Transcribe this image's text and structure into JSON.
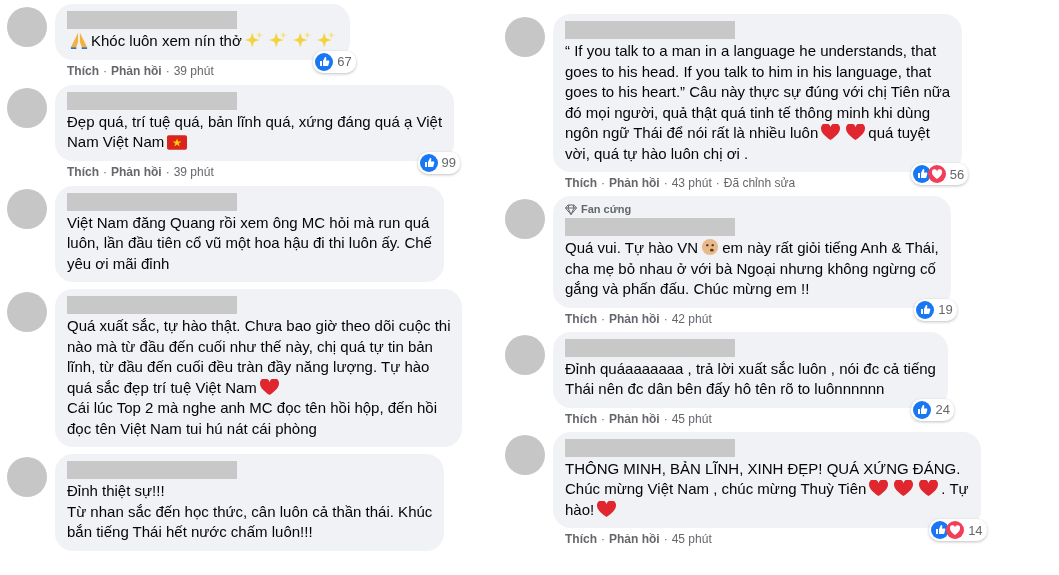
{
  "separator": "·",
  "columns": [
    {
      "comments": [
        {
          "author": {
            "redacted": true
          },
          "body": [
            [
              {
                "kind": "pray"
              },
              {
                "kind": "text",
                "text": "Khóc luôn xem nín thở"
              },
              {
                "kind": "sparkles"
              },
              {
                "kind": "sparkles"
              },
              {
                "kind": "sparkles"
              },
              {
                "kind": "sparkles"
              }
            ]
          ],
          "reactions": [
            {
              "kind": "like"
            }
          ],
          "reaction_count": "67",
          "actions": [
            "Thích",
            "Phản hồi"
          ],
          "time": "39 phút"
        },
        {
          "author": {
            "redacted": true
          },
          "body": [
            [
              {
                "kind": "text",
                "text": "Đẹp quá, trí tuệ quá, bản lĩnh quá, xứng đáng quá ạ Việt"
              }
            ],
            [
              {
                "kind": "text",
                "text": "Nam Việt Nam"
              },
              {
                "kind": "flag"
              }
            ]
          ],
          "reactions": [
            {
              "kind": "like"
            }
          ],
          "reaction_count": "99",
          "actions": [
            "Thích",
            "Phản hồi"
          ],
          "time": "39 phút"
        },
        {
          "author": {
            "redacted": true
          },
          "body": [
            [
              {
                "kind": "text",
                "text": "Việt Nam đăng Quang rồi xem ông MC hỏi mà run quá\nluôn, lần đầu tiên cổ vũ một hoa hậu đi thi luôn ấy. Chế\nyêu ơi mãi đỉnh"
              }
            ]
          ]
        },
        {
          "author": {
            "redacted": true
          },
          "body": [
            [
              {
                "kind": "text",
                "text": "Quá xuất sắc, tự hào thật. Chưa bao giờ theo dõi cuộc thi\nnào mà từ đầu đến cuối như thế này, chị quá tự tin bản\nlĩnh, từ đầu đến cuối đều tràn đầy năng lượng. Tự hào"
              }
            ],
            [
              {
                "kind": "text",
                "text": "quá sắc đẹp trí tuệ Việt Nam"
              },
              {
                "kind": "heart"
              }
            ],
            [
              {
                "kind": "text",
                "text": "Cái lúc Top 2 mà nghe anh MC đọc tên hồi hộp, đến hồi\nđọc tên Việt Nam tui hú nát cái phòng"
              }
            ]
          ]
        },
        {
          "author": {
            "redacted": true
          },
          "body": [
            [
              {
                "kind": "text",
                "text": "Đỉnh thiệt sự!!!\nTừ nhan sắc đến học thức, cân luôn cả thần thái. Khúc\nbắn tiếng Thái hết nước chấm luôn!!!"
              }
            ]
          ]
        }
      ]
    },
    {
      "comments": [
        {
          "author": {
            "redacted": true
          },
          "body": [
            [
              {
                "kind": "text",
                "text": "“ If you talk to a man in a language he understands, that\ngoes to his head. If you talk to him in his language, that\ngoes to his heart.” Câu này thực sự đúng với chị Tiên nữa\nđó mọi người, quả thật quá tinh tế thông minh khi dùng"
              }
            ],
            [
              {
                "kind": "text",
                "text": "ngôn ngữ Thái để nói rất là nhiều luôn"
              },
              {
                "kind": "heart"
              },
              {
                "kind": "heart"
              },
              {
                "kind": "text",
                "text": "quá tuyệt"
              }
            ],
            [
              {
                "kind": "text",
                "text": "vời, quá tự hào luôn chị ơi ."
              }
            ]
          ],
          "reactions": [
            {
              "kind": "like"
            },
            {
              "kind": "love"
            }
          ],
          "reaction_count": "56",
          "actions": [
            "Thích",
            "Phản hồi"
          ],
          "time": "43 phút",
          "edited": "Đã chỉnh sửa"
        },
        {
          "author": {
            "redacted": true
          },
          "badge": "Fan cứng",
          "body": [
            [
              {
                "kind": "text",
                "text": "Quá vui. Tự hào VN"
              },
              {
                "kind": "face"
              },
              {
                "kind": "text",
                "text": "em này rất giỏi tiếng Anh & Thái,"
              }
            ],
            [
              {
                "kind": "text",
                "text": "cha mẹ bỏ nhau ở với bà Ngoại nhưng không ngừng cố\ngắng và phấn đấu. Chúc mừng em !!"
              }
            ]
          ],
          "reactions": [
            {
              "kind": "like"
            }
          ],
          "reaction_count": "19",
          "actions": [
            "Thích",
            "Phản hồi"
          ],
          "time": "42 phút"
        },
        {
          "author": {
            "redacted": true
          },
          "body": [
            [
              {
                "kind": "text",
                "text": "Đỉnh quáaaaaaaa , trả lời xuất sắc luôn , nói đc cả tiếng\nThái nên đc dân bên đấy hô tên rõ to luônnnnnn"
              }
            ]
          ],
          "reactions": [
            {
              "kind": "like"
            }
          ],
          "reaction_count": "24",
          "actions": [
            "Thích",
            "Phản hồi"
          ],
          "time": "45 phút"
        },
        {
          "author": {
            "redacted": true
          },
          "body": [
            [
              {
                "kind": "text",
                "text": "THÔNG MINH, BẢN LĨNH, XINH ĐẸP! QUÁ XỨNG ĐÁNG."
              }
            ],
            [
              {
                "kind": "text",
                "text": "Chúc mừng Việt Nam , chúc mừng Thuỳ Tiên"
              },
              {
                "kind": "heart"
              },
              {
                "kind": "heart"
              },
              {
                "kind": "heart"
              },
              {
                "kind": "text",
                "text": ". Tự"
              }
            ],
            [
              {
                "kind": "text",
                "text": "hào!"
              },
              {
                "kind": "heart"
              }
            ]
          ],
          "reactions": [
            {
              "kind": "like"
            },
            {
              "kind": "love"
            }
          ],
          "reaction_count": "14",
          "actions": [
            "Thích",
            "Phản hồi"
          ],
          "time": "45 phút"
        }
      ]
    }
  ]
}
